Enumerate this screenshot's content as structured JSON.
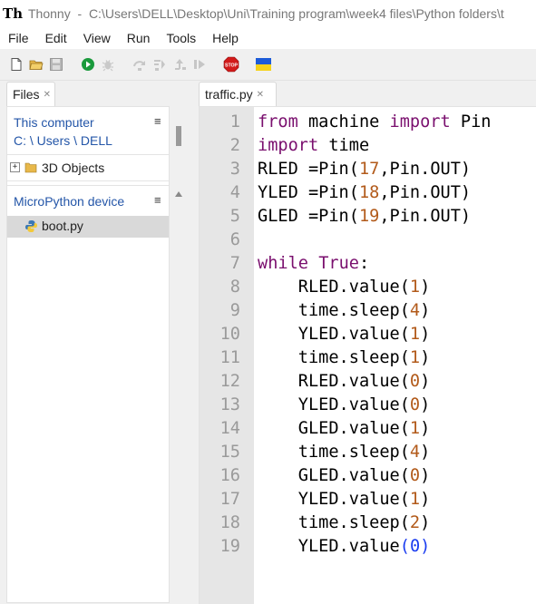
{
  "window": {
    "app_name": "Thonny",
    "separator": "-",
    "path": "C:\\Users\\DELL\\Desktop\\Uni\\Training program\\week4 files\\Python folders\\t"
  },
  "menu": [
    "File",
    "Edit",
    "View",
    "Run",
    "Tools",
    "Help"
  ],
  "toolbar": {
    "icons": [
      "new-file-icon",
      "open-folder-icon",
      "save-icon",
      "run-icon",
      "debug-icon",
      "step-over-icon",
      "step-into-icon",
      "step-out-icon",
      "resume-icon",
      "stop-icon",
      "ukraine-flag-icon"
    ],
    "stop_label": "STOP",
    "colors": {
      "run": "#1a9a3c",
      "stop": "#d21a1a",
      "flag_blue": "#1c5bd8",
      "flag_yellow": "#f5d21a"
    }
  },
  "files_panel": {
    "tab_label": "Files",
    "this_computer": {
      "title": "This computer",
      "path": "C: \\ Users \\ DELL",
      "items": [
        {
          "label": "3D Objects",
          "expander": "+"
        }
      ]
    },
    "device": {
      "title": "MicroPython device",
      "items": [
        {
          "label": "boot.py"
        }
      ]
    },
    "menu_glyph": "≡"
  },
  "editor": {
    "tab_label": "traffic.py",
    "lines": [
      {
        "n": "1",
        "tokens": [
          {
            "t": "from",
            "c": "kw"
          },
          {
            "t": " machine ",
            "c": ""
          },
          {
            "t": "import",
            "c": "kw"
          },
          {
            "t": " Pin",
            "c": ""
          }
        ]
      },
      {
        "n": "2",
        "tokens": [
          {
            "t": "import",
            "c": "kw"
          },
          {
            "t": " time",
            "c": ""
          }
        ]
      },
      {
        "n": "3",
        "tokens": [
          {
            "t": "RLED =Pin(",
            "c": ""
          },
          {
            "t": "17",
            "c": "num"
          },
          {
            "t": ",Pin.OUT)",
            "c": ""
          }
        ]
      },
      {
        "n": "4",
        "tokens": [
          {
            "t": "YLED =Pin(",
            "c": ""
          },
          {
            "t": "18",
            "c": "num"
          },
          {
            "t": ",Pin.OUT)",
            "c": ""
          }
        ]
      },
      {
        "n": "5",
        "tokens": [
          {
            "t": "GLED =Pin(",
            "c": ""
          },
          {
            "t": "19",
            "c": "num"
          },
          {
            "t": ",Pin.OUT)",
            "c": ""
          }
        ]
      },
      {
        "n": "6",
        "tokens": []
      },
      {
        "n": "7",
        "tokens": [
          {
            "t": "while",
            "c": "kw"
          },
          {
            "t": " ",
            "c": ""
          },
          {
            "t": "True",
            "c": "kw"
          },
          {
            "t": ":",
            "c": ""
          }
        ]
      },
      {
        "n": "8",
        "tokens": [
          {
            "t": "    RLED.value(",
            "c": ""
          },
          {
            "t": "1",
            "c": "num"
          },
          {
            "t": ")",
            "c": ""
          }
        ]
      },
      {
        "n": "9",
        "tokens": [
          {
            "t": "    time.sleep(",
            "c": ""
          },
          {
            "t": "4",
            "c": "num"
          },
          {
            "t": ")",
            "c": ""
          }
        ]
      },
      {
        "n": "10",
        "tokens": [
          {
            "t": "    YLED.value(",
            "c": ""
          },
          {
            "t": "1",
            "c": "num"
          },
          {
            "t": ")",
            "c": ""
          }
        ]
      },
      {
        "n": "11",
        "tokens": [
          {
            "t": "    time.sleep(",
            "c": ""
          },
          {
            "t": "1",
            "c": "num"
          },
          {
            "t": ")",
            "c": ""
          }
        ]
      },
      {
        "n": "12",
        "tokens": [
          {
            "t": "    RLED.value(",
            "c": ""
          },
          {
            "t": "0",
            "c": "num"
          },
          {
            "t": ")",
            "c": ""
          }
        ]
      },
      {
        "n": "13",
        "tokens": [
          {
            "t": "    YLED.value(",
            "c": ""
          },
          {
            "t": "0",
            "c": "num"
          },
          {
            "t": ")",
            "c": ""
          }
        ]
      },
      {
        "n": "14",
        "tokens": [
          {
            "t": "    GLED.value(",
            "c": ""
          },
          {
            "t": "1",
            "c": "num"
          },
          {
            "t": ")",
            "c": ""
          }
        ]
      },
      {
        "n": "15",
        "tokens": [
          {
            "t": "    time.sleep(",
            "c": ""
          },
          {
            "t": "4",
            "c": "num"
          },
          {
            "t": ")",
            "c": ""
          }
        ]
      },
      {
        "n": "16",
        "tokens": [
          {
            "t": "    GLED.value(",
            "c": ""
          },
          {
            "t": "0",
            "c": "num"
          },
          {
            "t": ")",
            "c": ""
          }
        ]
      },
      {
        "n": "17",
        "tokens": [
          {
            "t": "    YLED.value(",
            "c": ""
          },
          {
            "t": "1",
            "c": "num"
          },
          {
            "t": ")",
            "c": ""
          }
        ]
      },
      {
        "n": "18",
        "tokens": [
          {
            "t": "    time.sleep(",
            "c": ""
          },
          {
            "t": "2",
            "c": "num"
          },
          {
            "t": ")",
            "c": ""
          }
        ]
      },
      {
        "n": "19",
        "tokens": [
          {
            "t": "    YLED.value",
            "c": ""
          },
          {
            "t": "(",
            "c": "sel"
          },
          {
            "t": "0",
            "c": "sel"
          },
          {
            "t": ")",
            "c": "sel"
          }
        ]
      }
    ],
    "colors": {
      "keyword": "#7a0f6e",
      "number": "#b25a1a",
      "bracket_highlight": "#1a3cf0",
      "gutter": "#e6e6e6"
    }
  }
}
